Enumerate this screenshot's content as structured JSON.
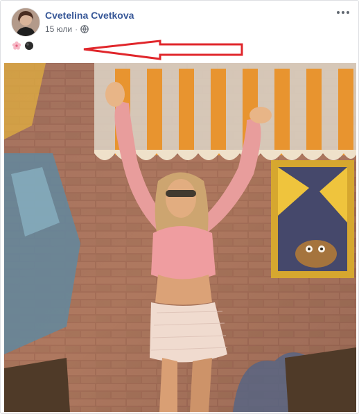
{
  "post": {
    "author": "Cvetelina Cvetkova",
    "date": "15 юли",
    "privacy_icon": "globe-icon",
    "more_icon": "ellipsis-icon",
    "emojis": [
      "cherry-blossom-emoji",
      "black-circle-emoji"
    ]
  },
  "annotation": {
    "icon": "red-arrow-left",
    "color": "#e0262b"
  },
  "photo": {
    "subject": "woman in pink crop top and white skirt posing against painted brick wall"
  }
}
